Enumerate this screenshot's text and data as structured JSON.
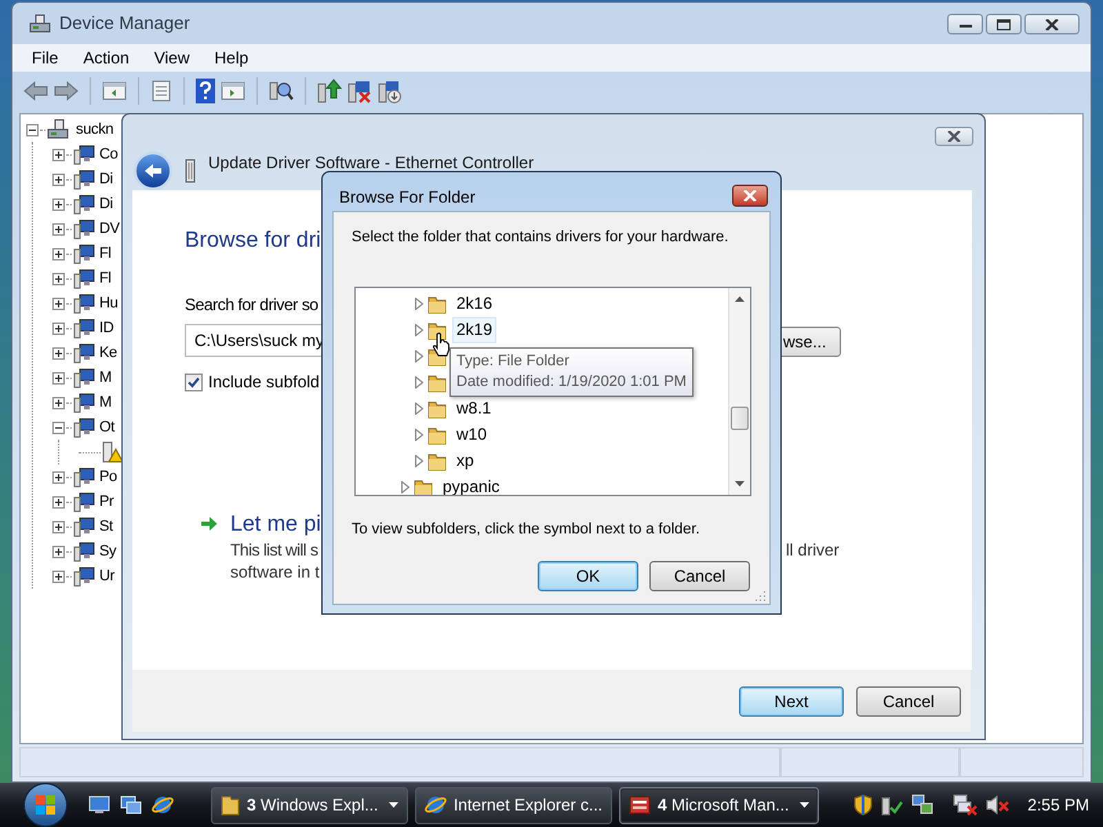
{
  "window": {
    "title": "Device Manager"
  },
  "menu": [
    "File",
    "Action",
    "View",
    "Help"
  ],
  "device_tree": {
    "root": {
      "label": "suckn",
      "expanded": true,
      "children": [
        {
          "label": "Co",
          "expanded": false
        },
        {
          "label": "Di",
          "expanded": false
        },
        {
          "label": "Di",
          "expanded": false
        },
        {
          "label": "DV",
          "expanded": false
        },
        {
          "label": "Fl",
          "expanded": false
        },
        {
          "label": "Fl",
          "expanded": false
        },
        {
          "label": "Hu",
          "expanded": false
        },
        {
          "label": "ID",
          "expanded": false
        },
        {
          "label": "Ke",
          "expanded": false
        },
        {
          "label": "M",
          "expanded": false
        },
        {
          "label": "M",
          "expanded": false
        },
        {
          "label": "Ot",
          "expanded": true,
          "children": [
            {
              "warning": true
            }
          ]
        },
        {
          "label": "Po",
          "expanded": false
        },
        {
          "label": "Pr",
          "expanded": false
        },
        {
          "label": "St",
          "expanded": false
        },
        {
          "label": "Sy",
          "expanded": false
        },
        {
          "label": "Ur",
          "expanded": false
        }
      ]
    }
  },
  "update_driver_dialog": {
    "title": "Update Driver Software - Ethernet Controller",
    "heading": "Browse for dri",
    "search_label": "Search for driver so",
    "path_value": "C:\\Users\\suck my",
    "browse_button": "wse...",
    "include_subfolders": {
      "label": "Include subfold",
      "checked": true
    },
    "pick_link": "Let me pi",
    "pick_description": [
      "This list will s",
      "software in t"
    ],
    "pick_description_right": "ll driver",
    "buttons": [
      {
        "label": "Next",
        "default": true
      },
      {
        "label": "Cancel",
        "default": false
      }
    ]
  },
  "browse_dialog": {
    "title": "Browse For Folder",
    "instruction": "Select the folder that contains drivers for your hardware.",
    "folders": [
      {
        "name": "2k16",
        "expanded": false,
        "hovered": false
      },
      {
        "name": "2k19",
        "expanded": false,
        "hovered": true
      },
      {
        "expanded": false
      },
      {
        "expanded": false
      },
      {
        "name": "w8.1",
        "expanded": false,
        "hovered": false
      },
      {
        "name": "w10",
        "expanded": false,
        "hovered": false
      },
      {
        "name": "xp",
        "expanded": false,
        "hovered": false
      }
    ],
    "parent_siblings": [
      {
        "name": "pypanic",
        "expanded": false
      }
    ],
    "tooltip": [
      "Type: File Folder",
      "Date modified: 1/19/2020 1:01 PM"
    ],
    "hint": "To view subfolders, click the symbol next to a folder.",
    "buttons": [
      {
        "label": "OK",
        "default": true
      },
      {
        "label": "Cancel",
        "default": false
      }
    ]
  },
  "taskbar": {
    "buttons": [
      {
        "label": "**3** Windows Expl...",
        "selected": false,
        "menu": true,
        "kind": "folder"
      },
      {
        "label": "Internet Explorer c...",
        "selected": false,
        "menu": false,
        "kind": "browser"
      },
      {
        "label": "**4** Microsoft Man...",
        "selected": true,
        "menu": true,
        "kind": "app"
      }
    ],
    "clock": "2:55 PM"
  }
}
